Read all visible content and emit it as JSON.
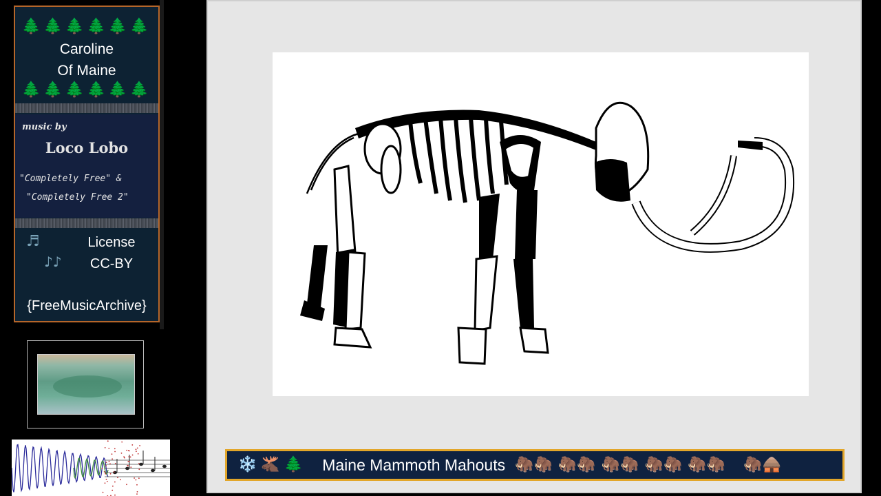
{
  "card": {
    "title_line1": "Caroline",
    "title_line2": "Of Maine",
    "trees": "🌲🌲🌲🌲🌲🌲",
    "music_by": "music by",
    "artist": "Loco Lobo",
    "album_line1": "\"Completely Free\" &",
    "album_line2": "\"Completely Free 2\"",
    "license_label": "License",
    "license_value": "CC-BY",
    "source": "{FreeMusicArchive}",
    "note_icon_1": "♬",
    "note_icon_2": "♪♪"
  },
  "banner": {
    "title": "Maine Mammoth Mahouts",
    "icons_left": [
      "snowflake-icon",
      "moose-icon",
      "evergreen-icon"
    ],
    "snowflake": "❄️",
    "moose": "🫎",
    "evergreen": "🌲",
    "mammoth_groups": 5,
    "mammoth": "🦣",
    "hut": "🛖"
  },
  "colors": {
    "card_bg": "#0d2233",
    "card_border": "#b5662a",
    "banner_bg": "#0f2240",
    "banner_border": "#e2a62a",
    "viewer_bg": "#e6e6e6"
  }
}
